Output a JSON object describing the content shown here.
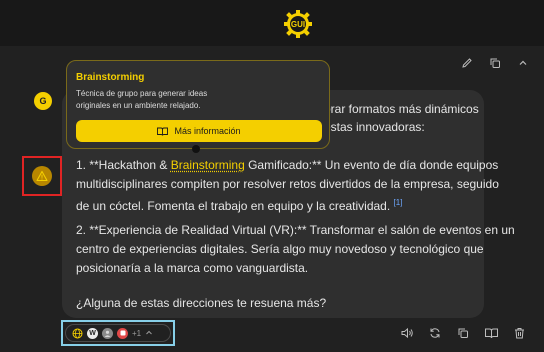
{
  "header": {
    "logo_text": "GUI"
  },
  "avatar": {
    "initial": "G"
  },
  "tooltip": {
    "title": "Brainstorming",
    "description": "Técnica de grupo para generar ideas originales en un ambiente relajado.",
    "button_label": "Más información"
  },
  "message": {
    "line1_tail": "orar formatos más dinámicos",
    "line2_tail": "estas innovadoras:",
    "item1": {
      "prefix": "1. **Hackathon & ",
      "keyword": "Brainstorming",
      "rest": " Gamificado:** Un evento de día donde equipos",
      "line2": "multidisciplinares compiten por resolver retos divertidos de la empresa, seguido",
      "line3": "de un cóctel. Fomenta el trabajo en equipo y la creatividad.",
      "cite": "[1]"
    },
    "item2": {
      "line1": "2. **Experiencia de Realidad Virtual (VR):** Transformar el salón de eventos en un",
      "line2": "centro de experiencias digitales. Sería algo muy novedoso y tecnológico que",
      "line3": "posicionaría a la marca como vanguardista."
    },
    "question": "¿Alguna de estas direcciones te resuena más?"
  },
  "models": {
    "more_count": "+1"
  },
  "colors": {
    "accent": "#f4cf00",
    "warning_box": "#e02424",
    "models_box": "#87cfe8"
  }
}
